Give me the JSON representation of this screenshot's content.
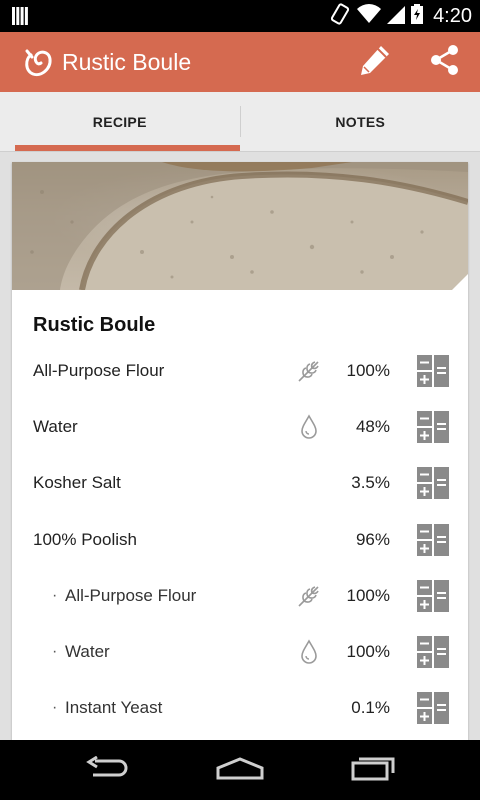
{
  "status": {
    "time": "4:20"
  },
  "app": {
    "title": "Rustic Boule",
    "accent": "#d56a50"
  },
  "tabs": [
    {
      "label": "RECIPE",
      "active": true
    },
    {
      "label": "NOTES",
      "active": false
    }
  ],
  "recipe": {
    "title": "Rustic Boule",
    "ingredients": [
      {
        "name": "All-Purpose Flour",
        "icon": "wheat-icon",
        "percent": "100%",
        "sub": false
      },
      {
        "name": "Water",
        "icon": "water-drop-icon",
        "percent": "48%",
        "sub": false
      },
      {
        "name": "Kosher Salt",
        "icon": "",
        "percent": "3.5%",
        "sub": false
      },
      {
        "name": "100% Poolish",
        "icon": "",
        "percent": "96%",
        "sub": false
      },
      {
        "name": "All-Purpose Flour",
        "icon": "wheat-icon",
        "percent": "100%",
        "sub": true
      },
      {
        "name": "Water",
        "icon": "water-drop-icon",
        "percent": "100%",
        "sub": true
      },
      {
        "name": "Instant Yeast",
        "icon": "",
        "percent": "0.1%",
        "sub": true
      }
    ]
  }
}
